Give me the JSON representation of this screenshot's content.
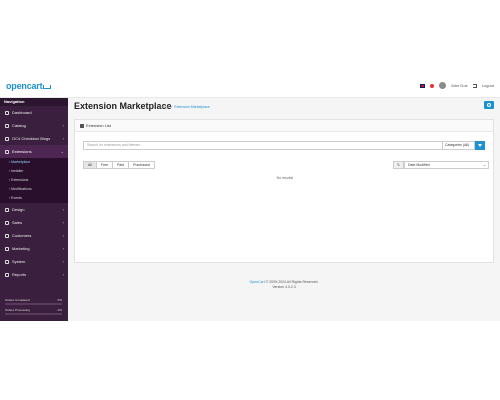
{
  "header": {
    "logo": "opencart",
    "user_name": "John Doe",
    "logout_label": "Logout"
  },
  "sidebar": {
    "title": "Navigation",
    "items": [
      {
        "label": "Dashboard"
      },
      {
        "label": "Catalog"
      },
      {
        "label": "OC4 Checkbox Blogs"
      },
      {
        "label": "Extensions"
      },
      {
        "label": "Design"
      },
      {
        "label": "Sales"
      },
      {
        "label": "Customers"
      },
      {
        "label": "Marketing"
      },
      {
        "label": "System"
      },
      {
        "label": "Reports"
      }
    ],
    "submenu": [
      "Marketplace",
      "Installer",
      "Extensions",
      "Modifications",
      "Events"
    ],
    "progress": [
      {
        "label": "Orders Completed",
        "value": "0%",
        "fraction": 0
      },
      {
        "label": "Orders Processing",
        "value": "0%",
        "fraction": 0
      }
    ]
  },
  "main": {
    "page_title": "Extension Marketplace",
    "breadcrumb": {
      "home": "Home",
      "current": "Extension Marketplace"
    },
    "card_title": "Extension List",
    "search_placeholder": "Search for extensions and themes",
    "category_select": "Categories (All)",
    "filter_tabs": [
      "All",
      "Free",
      "Paid",
      "Purchased"
    ],
    "sort_select": "Date Modified",
    "no_results": "No results!"
  },
  "footer": {
    "link": "OpenCart",
    "copyright": "© 2009-2024 All Rights Reserved.",
    "version": "Version 4.0.2.3"
  },
  "colors": {
    "accent": "#1e91cf",
    "sidebar_bg": "#3b1f3f"
  }
}
